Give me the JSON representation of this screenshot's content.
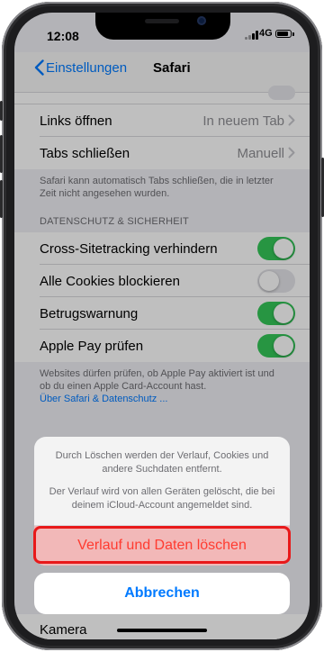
{
  "status": {
    "time": "12:08",
    "network": "4G"
  },
  "navbar": {
    "back_label": "Einstellungen",
    "title": "Safari"
  },
  "rows": [
    {
      "label": "Links öffnen",
      "value": "In neuem Tab"
    },
    {
      "label": "Tabs schließen",
      "value": "Manuell"
    }
  ],
  "tabs_footer": "Safari kann automatisch Tabs schließen, die in letzter Zeit nicht angesehen wurden.",
  "privacy": {
    "header": "DATENSCHUTZ & SICHERHEIT",
    "toggles": [
      {
        "label": "Cross-Sitetracking verhindern",
        "on": true
      },
      {
        "label": "Alle Cookies blockieren",
        "on": false
      },
      {
        "label": "Betrugswarnung",
        "on": true
      },
      {
        "label": "Apple Pay prüfen",
        "on": true
      }
    ],
    "footer": "Websites dürfen prüfen, ob Apple Pay aktiviert ist und ob du einen Apple Card-Account hast.",
    "footer_link": "Über Safari & Datenschutz ..."
  },
  "bottom_row": {
    "label": "Kamera"
  },
  "action_sheet": {
    "message_1": "Durch Löschen werden der Verlauf, Cookies und andere Suchdaten entfernt.",
    "message_2": "Der Verlauf wird von allen Geräten gelöscht, die bei deinem iCloud-Account angemeldet sind.",
    "destructive_label": "Verlauf und Daten löschen",
    "cancel_label": "Abbrechen"
  },
  "colors": {
    "accent": "#007aff",
    "toggle_on": "#34c759",
    "destructive": "#ff3b30",
    "highlight": "#e8191a"
  }
}
